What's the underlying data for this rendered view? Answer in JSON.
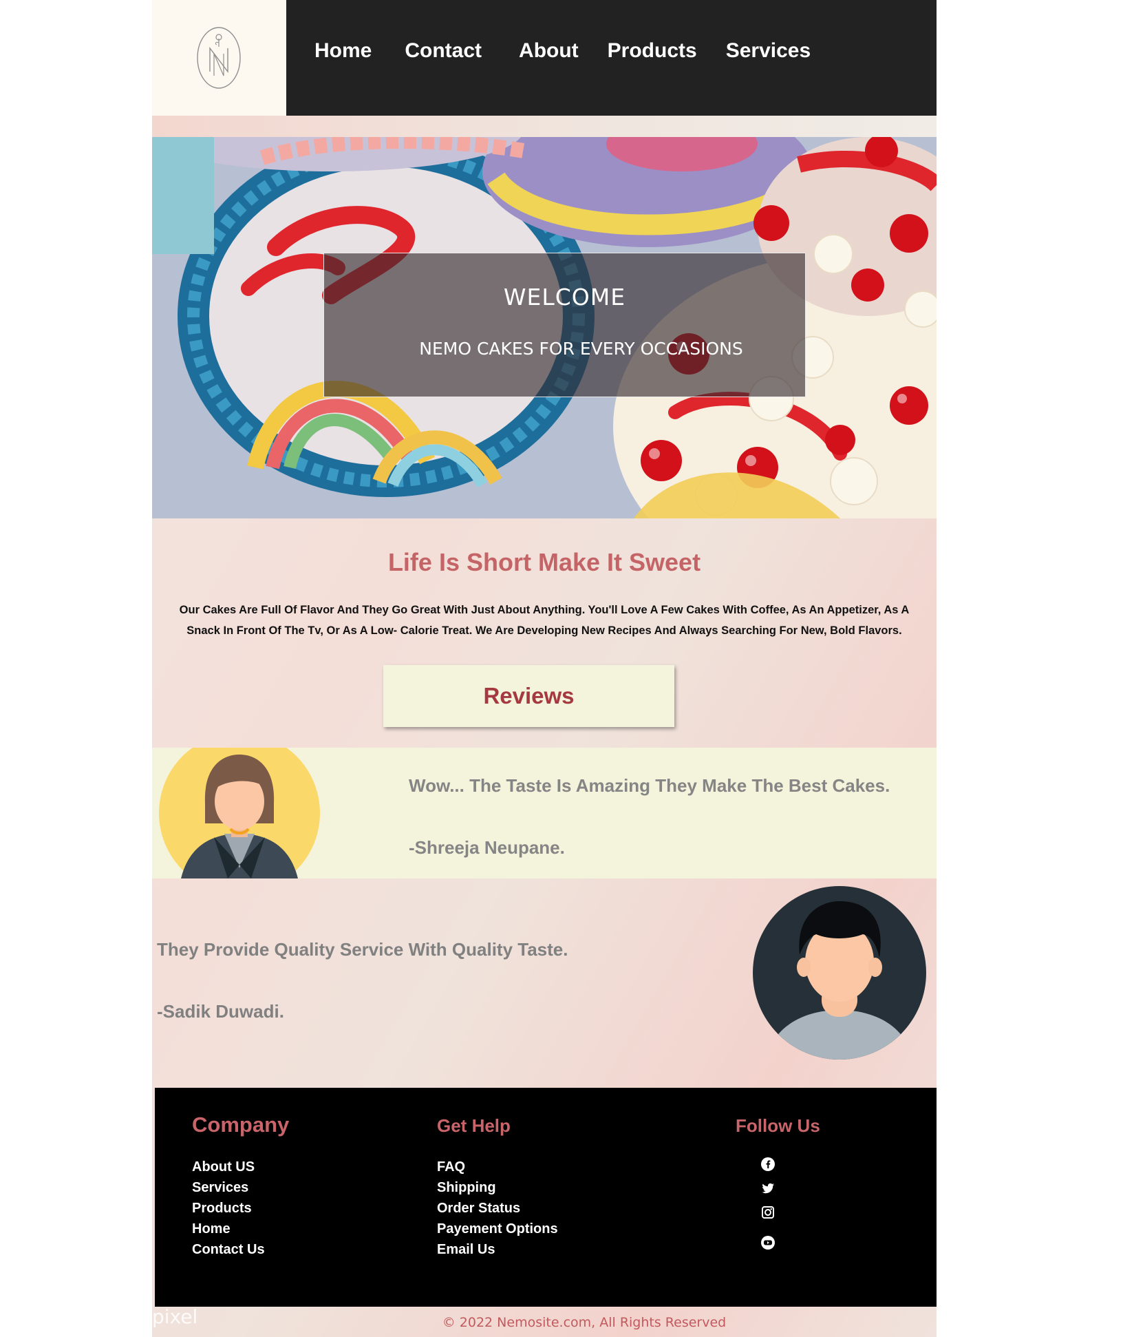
{
  "nav": {
    "items": [
      {
        "label": "Home"
      },
      {
        "label": "Contact"
      },
      {
        "label": "About"
      },
      {
        "label": "Products"
      },
      {
        "label": "Services"
      }
    ]
  },
  "logo": {
    "icon": "nn-monogram-logo"
  },
  "hero": {
    "title": "WELCOME",
    "subtitle": "NEMO CAKES FOR EVERY OCCASIONS",
    "image": "decorated-cakes-photo"
  },
  "intro": {
    "tagline": "Life Is Short Make It Sweet",
    "line1": "Our Cakes Are Full Of Flavor And They Go Great With Just About Anything. You'll Love A Few Cakes With Coffee, As An Appetizer, As A",
    "line2": "Snack In Front Of The Tv, Or As A Low- Calorie Treat. We Are Developing New Recipes And Always Searching For New, Bold Flavors.",
    "reviews_button": "Reviews"
  },
  "reviews": [
    {
      "text": "Wow... The Taste Is Amazing They Make The Best Cakes.",
      "author": "-Shreeja Neupane."
    },
    {
      "text": "They Provide Quality Service With Quality Taste.",
      "author": "-Sadik Duwadi."
    }
  ],
  "footer": {
    "company": {
      "heading": "Company",
      "links": [
        "About US",
        "Services",
        "Products",
        "Home",
        "Contact Us"
      ]
    },
    "help": {
      "heading": "Get Help",
      "links": [
        "FAQ",
        "Shipping",
        "Order Status",
        "Payement Options",
        "Email Us"
      ]
    },
    "follow": {
      "heading": "Follow Us",
      "icons": [
        "facebook-icon",
        "twitter-icon",
        "instagram-icon",
        "youtube-icon"
      ]
    }
  },
  "copyright": "© 2022 Nemosite.com, All Rights Reserved",
  "watermark": "pixel",
  "colors": {
    "header_bg": "#222222",
    "accent": "#c56466",
    "review_band": "#f4f3dc",
    "footer_bg": "#000000"
  }
}
